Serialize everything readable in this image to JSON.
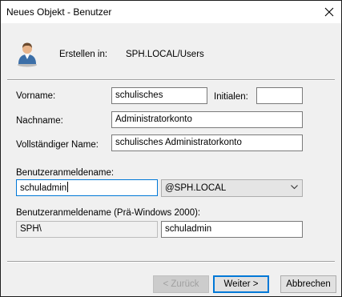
{
  "window": {
    "title": "Neues Objekt - Benutzer"
  },
  "header": {
    "create_in_label": "Erstellen in:",
    "create_in_value": "SPH.LOCAL/Users",
    "icon": "user-icon"
  },
  "form": {
    "firstname_label": "Vorname:",
    "firstname_value": "schulisches",
    "initials_label": "Initialen:",
    "initials_value": "",
    "lastname_label": "Nachname:",
    "lastname_value": "Administratorkonto",
    "fullname_label": "Vollständiger Name:",
    "fullname_value": "schulisches Administratorkonto",
    "logon_label": "Benutzeranmeldename:",
    "logon_value": "schuladmin",
    "domain_value": "@SPH.LOCAL",
    "prewin_label": "Benutzeranmeldename (Prä-Windows 2000):",
    "prewin_domain_value": "SPH\\",
    "prewin_user_value": "schuladmin"
  },
  "buttons": {
    "back": "< Zurück",
    "next": "Weiter >",
    "cancel": "Abbrechen"
  }
}
